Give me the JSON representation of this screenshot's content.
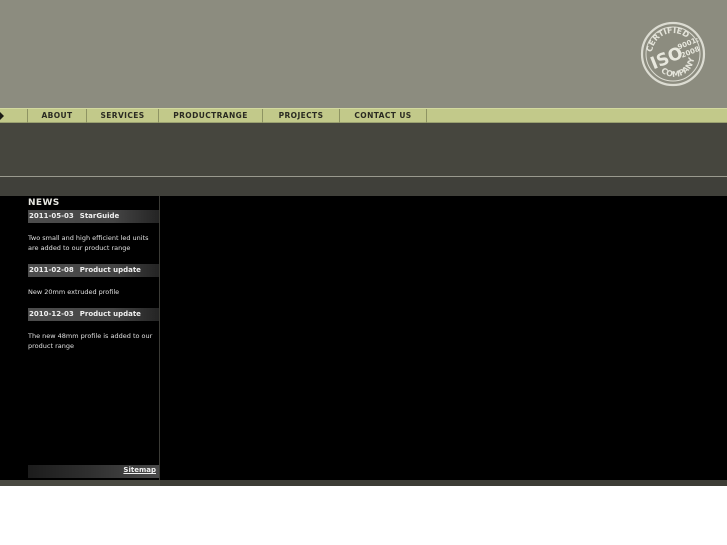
{
  "header": {
    "seal": {
      "line1": "CERTIFIED",
      "line2": "ISO",
      "line3": "9001:",
      "line4": "2008",
      "line5": "COMPANY"
    }
  },
  "nav": {
    "items": [
      "ABOUT",
      "SERVICES",
      "PRODUCTRANGE",
      "PROJECTS",
      "CONTACT US"
    ]
  },
  "news": {
    "title": "NEWS",
    "items": [
      {
        "date": "2011-05-03",
        "headline": "StarGuide",
        "body": "Two small and high efficient led units are added to our product range"
      },
      {
        "date": "2011-02-08",
        "headline": "Product update",
        "body": "New 20mm extruded profile"
      },
      {
        "date": "2010-12-03",
        "headline": "Product update",
        "body": "The new 48mm profile is added to our product range"
      }
    ]
  },
  "footer": {
    "sitemap": "Sitemap"
  },
  "colors": {
    "header": "#8c8c7f",
    "nav": "#c2c98a",
    "band": "#46463e",
    "main": "#000000"
  }
}
